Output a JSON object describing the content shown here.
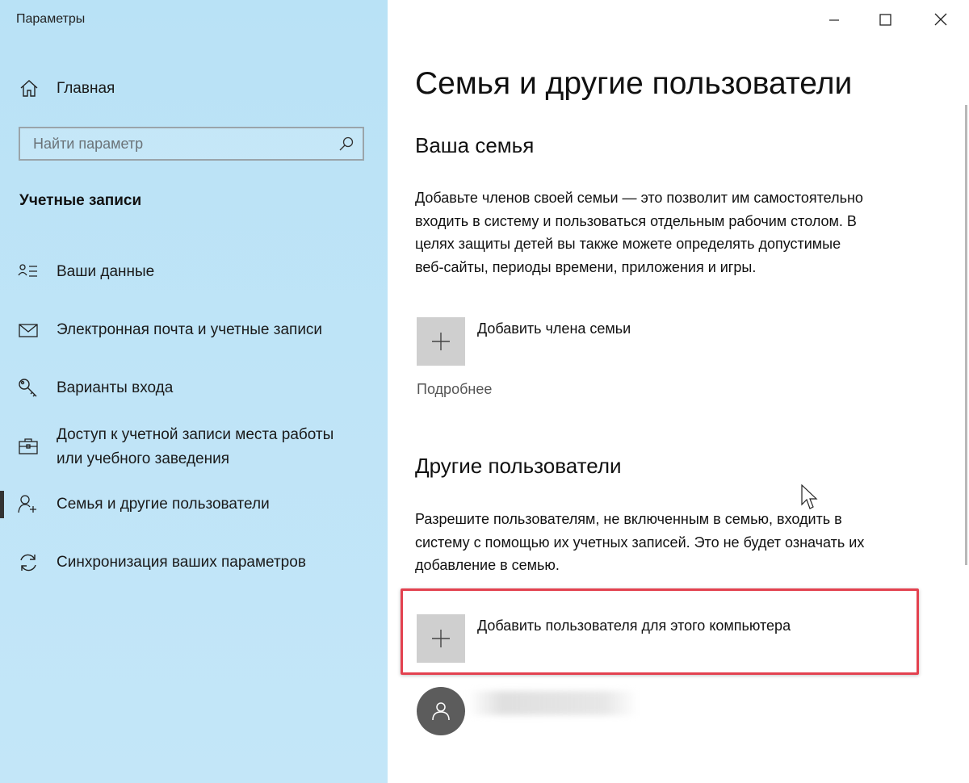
{
  "window": {
    "app_title": "Параметры"
  },
  "sidebar": {
    "home_label": "Главная",
    "search_placeholder": "Найти параметр",
    "section_title": "Учетные записи",
    "items": [
      {
        "label": "Ваши данные",
        "icon": "user-card-icon"
      },
      {
        "label": "Электронная почта и учетные записи",
        "icon": "mail-icon"
      },
      {
        "label": "Варианты входа",
        "icon": "key-icon"
      },
      {
        "label_line1": "Доступ к учетной записи места работы",
        "label_line2": "или учебного заведения",
        "icon": "briefcase-icon"
      },
      {
        "label": "Семья и другие пользователи",
        "icon": "add-person-icon",
        "active": true
      },
      {
        "label": "Синхронизация ваших параметров",
        "icon": "sync-icon"
      }
    ]
  },
  "main": {
    "page_title": "Семья и другие пользователи",
    "family": {
      "heading": "Ваша семья",
      "description_lines": [
        "Добавьте членов своей семьи — это позволит им самостоятельно",
        "входить в систему и пользоваться отдельным рабочим столом. В",
        "целях защиты детей вы также можете определять допустимые",
        "веб-сайты, периоды времени, приложения и игры."
      ],
      "add_label": "Добавить члена семьи",
      "more_link": "Подробнее"
    },
    "others": {
      "heading": "Другие пользователи",
      "description_lines": [
        "Разрешите пользователям, не включенным в семью, входить в",
        "систему с помощью их учетных записей. Это не будет означать их",
        "добавление в семью."
      ],
      "add_label": "Добавить пользователя для этого компьютера"
    }
  },
  "colors": {
    "sidebar_bg": "#bfe4f7",
    "highlight_border": "#e3414f",
    "tile_bg": "#cfcfcf",
    "avatar_bg": "#5c5c5c"
  }
}
